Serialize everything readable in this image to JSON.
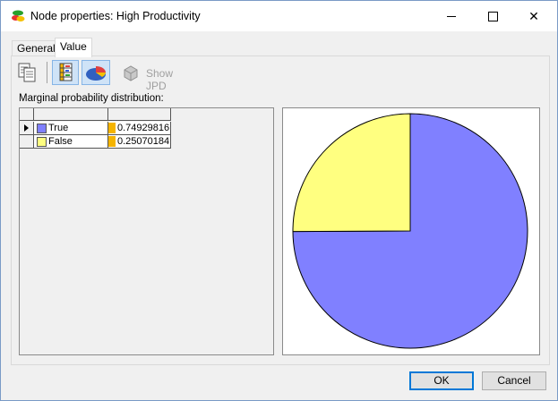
{
  "window": {
    "title": "Node properties: High Productivity",
    "controls": {
      "minimize": "minimize",
      "maximize": "maximize",
      "close": "✕"
    }
  },
  "tabs": [
    {
      "label": "General",
      "active": false
    },
    {
      "label": "Value",
      "active": true
    }
  ],
  "toolbar": {
    "show_jpd_label": "Show JPD",
    "icons": [
      "copy-icon",
      "table-view-icon",
      "pie-chart-icon",
      "show-jpd-icon"
    ]
  },
  "marginal_label": "Marginal probability distribution:",
  "states": [
    {
      "name": "True",
      "value_text": "0.74929816",
      "value": 0.74929816,
      "color": "#8080ff",
      "selected": true
    },
    {
      "name": "False",
      "value_text": "0.25070184",
      "value": 0.25070184,
      "color": "#ffff80",
      "selected": false
    }
  ],
  "chart_data": {
    "type": "pie",
    "categories": [
      "True",
      "False"
    ],
    "values": [
      0.74929816,
      0.25070184
    ],
    "colors": [
      "#8080ff",
      "#ffff80"
    ]
  },
  "buttons": {
    "ok": "OK",
    "cancel": "Cancel"
  },
  "colors": {
    "bar_fill": "#f5b400",
    "selection": "#cfe3f7"
  }
}
